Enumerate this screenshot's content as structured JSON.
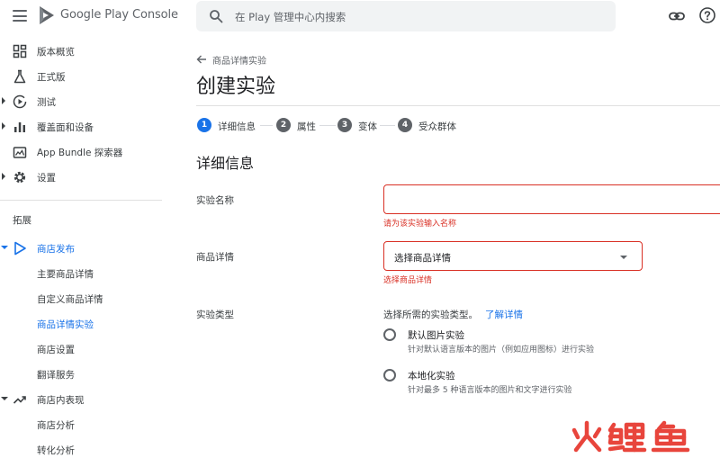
{
  "header": {
    "brand": "Google Play Console",
    "search_placeholder": "在 Play 管理中心内搜索"
  },
  "sidebar": {
    "items": [
      {
        "label": "版本概览",
        "icon": "dashboard-icon"
      },
      {
        "label": "正式版",
        "icon": "flask-icon"
      },
      {
        "label": "测试",
        "icon": "play-circle-icon"
      },
      {
        "label": "覆盖面和设备",
        "icon": "bar-chart-icon"
      },
      {
        "label": "App Bundle 探索器",
        "icon": "bundle-icon"
      },
      {
        "label": "设置",
        "icon": "gear-icon"
      }
    ],
    "section_title": "拓展",
    "store_presence": "商店发布",
    "store_items": [
      "主要商品详情",
      "自定义商品详情",
      "商品详情实验",
      "商店设置",
      "翻译服务"
    ],
    "store_performance": "商店内表现",
    "performance_items": [
      "商店分析",
      "转化分析"
    ]
  },
  "main": {
    "back_label": "商品详情实验",
    "title": "创建实验",
    "steps": [
      {
        "num": "1",
        "label": "详细信息"
      },
      {
        "num": "2",
        "label": "属性"
      },
      {
        "num": "3",
        "label": "变体"
      },
      {
        "num": "4",
        "label": "受众群体"
      }
    ],
    "section_heading": "详细信息",
    "name_label": "实验名称",
    "name_error": "请为该实验输入名称",
    "listing_label": "商品详情",
    "listing_select": "选择商品详情",
    "listing_error": "选择商品详情",
    "type_label": "实验类型",
    "type_desc": "选择所需的实验类型。",
    "type_link": "了解详情",
    "options": [
      {
        "title": "默认图片实验",
        "desc": "针对默认语言版本的图片（例如应用图标）进行实验"
      },
      {
        "title": "本地化实验",
        "desc": "针对最多 5 种语言版本的图片和文字进行实验"
      }
    ]
  },
  "watermark": "火鲤鱼",
  "colors": {
    "accent": "#1a73e8",
    "error": "#d93025",
    "watermark": "#e8453c"
  }
}
